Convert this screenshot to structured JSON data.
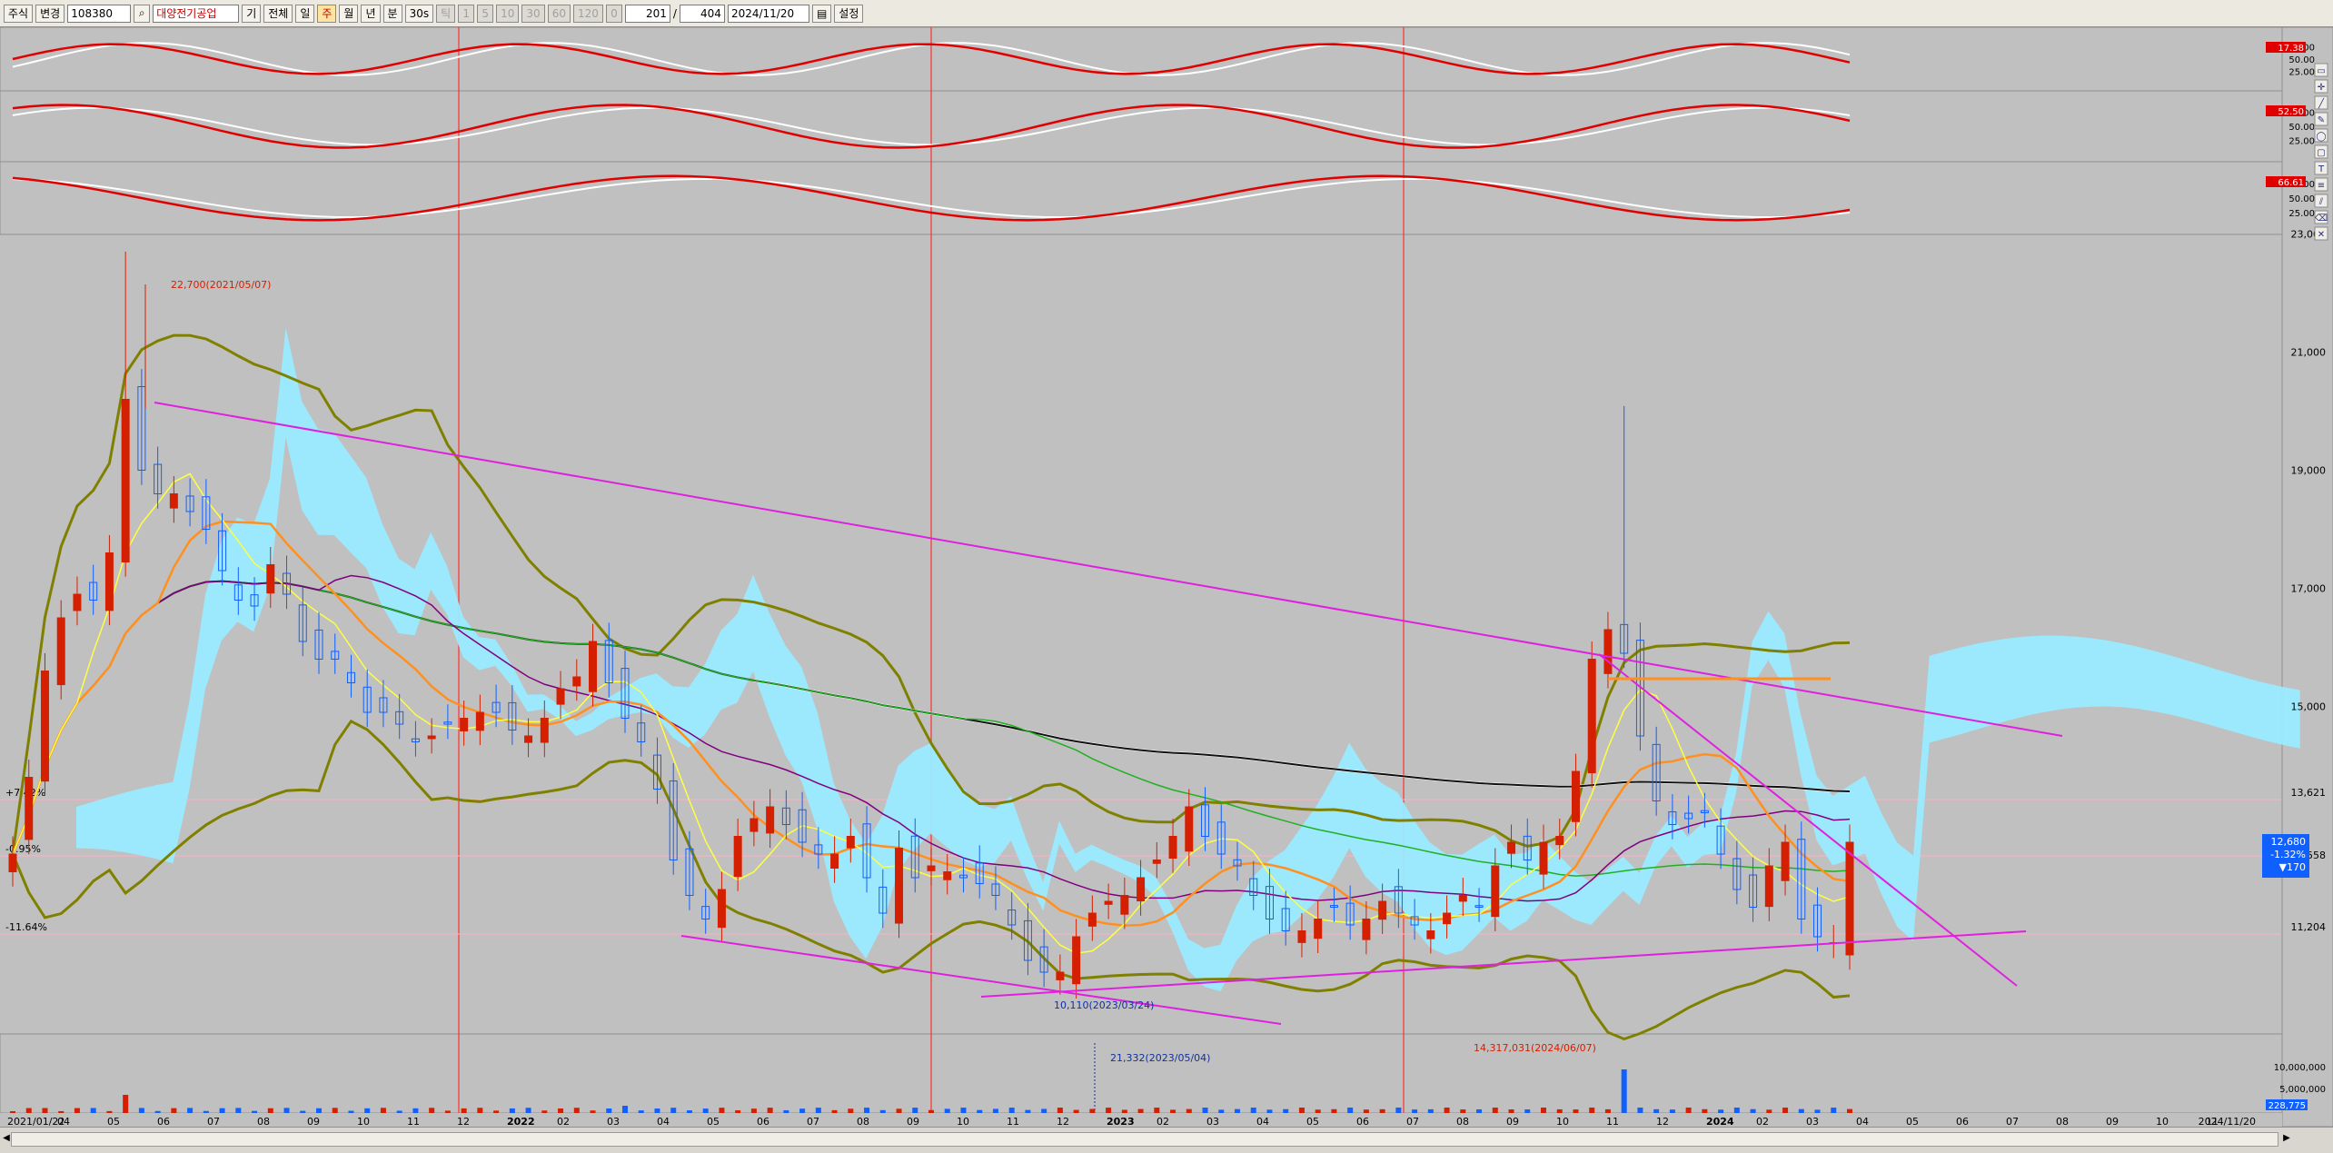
{
  "toolbar": {
    "market": "주식",
    "change_label": "변경",
    "code": "108380",
    "name": "대양전기공업",
    "items": [
      "기",
      "전체",
      "일",
      "주",
      "월",
      "년",
      "분",
      "30s",
      "틱"
    ],
    "periods": [
      "1",
      "5",
      "10",
      "30",
      "60",
      "120",
      "0"
    ],
    "count": "201",
    "total": "404",
    "date": "2024/11/20",
    "settings": "설정"
  },
  "icons": [
    "line-tool-icon",
    "crosshair-icon",
    "trendline-icon",
    "pen-icon",
    "circle-icon",
    "rect-icon",
    "text-icon",
    "fib-icon",
    "channel-icon",
    "eraser-icon",
    "delete-icon"
  ],
  "colors": {
    "up": "#d42000",
    "down": "#1060ff",
    "cloud": "#9aeaff",
    "trend": "#e020e0",
    "ma5": "#ffff40",
    "ma10": "#ff9020",
    "ma20": "#800080",
    "ma60": "#20b020",
    "ma120": "#101010",
    "ma240": "#ffffff",
    "bb": "#808000",
    "vline": "#ff3030",
    "hline": "#ffb0c8",
    "stoch_k": "#e00000",
    "stoch_d": "#ffffff"
  },
  "chart_data": {
    "type": "candlestick",
    "stock": "대양전기공업 (108380)",
    "period": "weekly",
    "ylim": [
      9500,
      24500
    ],
    "y_ticks": [
      "23,000",
      "21,000",
      "19,000",
      "17,000",
      "15,000",
      "13,621",
      "12,558",
      "11,204"
    ],
    "x_ticks": [
      "2021/01/22",
      "04",
      "05",
      "06",
      "07",
      "08",
      "09",
      "10",
      "11",
      "12",
      "2022",
      "02",
      "03",
      "04",
      "05",
      "06",
      "07",
      "08",
      "09",
      "10",
      "11",
      "12",
      "2023",
      "02",
      "03",
      "04",
      "05",
      "06",
      "07",
      "08",
      "09",
      "10",
      "11",
      "12",
      "2024",
      "02",
      "03",
      "04",
      "05",
      "06",
      "07",
      "08",
      "09",
      "10",
      "11",
      "2024/11/20"
    ],
    "closes": [
      12500,
      13800,
      15600,
      16500,
      16900,
      16800,
      17600,
      20200,
      19000,
      18600,
      18600,
      18300,
      18000,
      17300,
      16800,
      16700,
      17400,
      16900,
      16100,
      15800,
      15800,
      15400,
      14900,
      14900,
      14700,
      14400,
      14500,
      14700,
      14800,
      14900,
      14900,
      14600,
      14500,
      14800,
      15300,
      15500,
      16100,
      15400,
      14800,
      14400,
      13600,
      12400,
      11800,
      11400,
      11900,
      12800,
      13100,
      13300,
      13000,
      12700,
      12500,
      12500,
      12800,
      12100,
      11500,
      12600,
      12100,
      12300,
      12200,
      12100,
      12000,
      11800,
      11300,
      10700,
      10500,
      10500,
      11100,
      11500,
      11700,
      11800,
      12100,
      12400,
      12800,
      13300,
      12800,
      12500,
      12300,
      11800,
      11400,
      11200,
      11200,
      11400,
      11600,
      11300,
      11400,
      11700,
      11500,
      11300,
      11200,
      11500,
      11800,
      11600,
      12300,
      12700,
      12400,
      12700,
      12800,
      13900,
      15800,
      16300,
      15900,
      14500,
      13400,
      13000,
      13100,
      13200,
      12500,
      11900,
      11600,
      12300,
      12700,
      11400,
      11100,
      11000,
      12700
    ],
    "high_annotation": "22,700(2021/05/07)",
    "low_annotation": "10,110(2023/03/24)",
    "volume_annotation": "14,317,031(2024/06/07)",
    "volume_line_annotation": "21,332(2023/05/04)",
    "pct_labels": [
      "+7.42%",
      "-0.95%",
      "-11.64%"
    ],
    "current": {
      "price": "12,680",
      "change": "-1.32%",
      "diff": "▼170"
    },
    "stoch_panels": [
      {
        "ticks": [
          "75.00",
          "50.00",
          "25.00"
        ],
        "value": "17.38"
      },
      {
        "ticks": [
          "75.00",
          "50.00",
          "25.00"
        ],
        "value": "52.50"
      },
      {
        "ticks": [
          "75.00",
          "50.00",
          "25.00"
        ],
        "value": "66.61"
      }
    ],
    "volume_ticks": [
      "10,000,000",
      "5,000,000"
    ],
    "volume_value": "228,775"
  }
}
